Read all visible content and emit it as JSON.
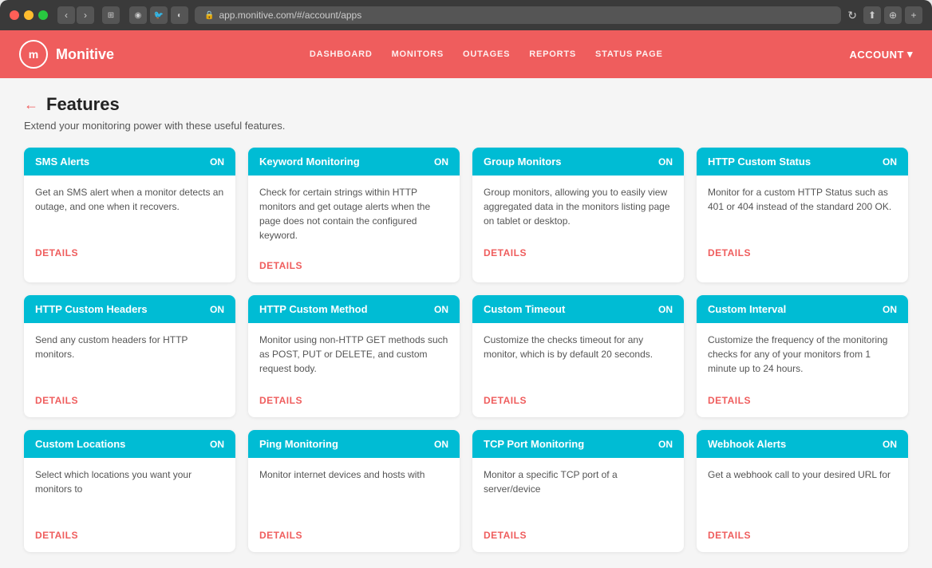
{
  "browser": {
    "url": "app.monitive.com/#/account/apps",
    "back_label": "‹",
    "forward_label": "›"
  },
  "header": {
    "logo_letter": "m",
    "brand_name": "Monitive",
    "nav_items": [
      "DASHBOARD",
      "MONITORS",
      "OUTAGES",
      "REPORTS",
      "STATUS PAGE"
    ],
    "account_label": "ACCOUNT"
  },
  "page": {
    "back_label": "←",
    "title": "Features",
    "subtitle": "Extend your monitoring power with these useful features."
  },
  "features": [
    {
      "title": "SMS Alerts",
      "status": "ON",
      "description": "Get an SMS alert when a monitor detects an outage, and one when it recovers.",
      "details_label": "DETAILS"
    },
    {
      "title": "Keyword Monitoring",
      "status": "ON",
      "description": "Check for certain strings within HTTP monitors and get outage alerts when the page does not contain the configured keyword.",
      "details_label": "DETAILS"
    },
    {
      "title": "Group Monitors",
      "status": "ON",
      "description": "Group monitors, allowing you to easily view aggregated data in the monitors listing page on tablet or desktop.",
      "details_label": "DETAILS"
    },
    {
      "title": "HTTP Custom Status",
      "status": "ON",
      "description": "Monitor for a custom HTTP Status such as 401 or 404 instead of the standard 200 OK.",
      "details_label": "DETAILS"
    },
    {
      "title": "HTTP Custom Headers",
      "status": "ON",
      "description": "Send any custom headers for HTTP monitors.",
      "details_label": "DETAILS"
    },
    {
      "title": "HTTP Custom Method",
      "status": "ON",
      "description": "Monitor using non-HTTP GET methods such as POST, PUT or DELETE, and custom request body.",
      "details_label": "DETAILS"
    },
    {
      "title": "Custom Timeout",
      "status": "ON",
      "description": "Customize the checks timeout for any monitor, which is by default 20 seconds.",
      "details_label": "DETAILS"
    },
    {
      "title": "Custom Interval",
      "status": "ON",
      "description": "Customize the frequency of the monitoring checks for any of your monitors from 1 minute up to 24 hours.",
      "details_label": "DETAILS"
    },
    {
      "title": "Custom Locations",
      "status": "ON",
      "description": "Select which locations you want your monitors to",
      "details_label": "DETAILS"
    },
    {
      "title": "Ping Monitoring",
      "status": "ON",
      "description": "Monitor internet devices and hosts with",
      "details_label": "DETAILS"
    },
    {
      "title": "TCP Port Monitoring",
      "status": "ON",
      "description": "Monitor a specific TCP port of a server/device",
      "details_label": "DETAILS"
    },
    {
      "title": "Webhook Alerts",
      "status": "ON",
      "description": "Get a webhook call to your desired URL for",
      "details_label": "DETAILS"
    }
  ]
}
